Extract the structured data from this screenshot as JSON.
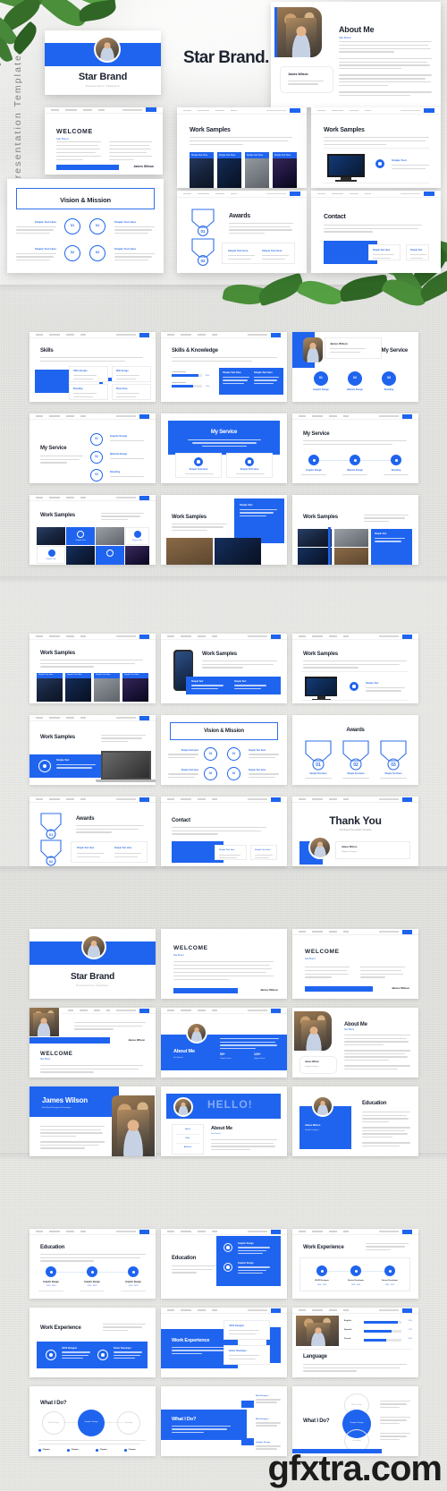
{
  "meta": {
    "side_label": "Presentation Template",
    "watermark": "gfxtra.com"
  },
  "hero": {
    "cover_title": "Star Brand",
    "cover_subtitle": "Presentation Template",
    "brand_wordmark": "Star Brand.",
    "about": {
      "title": "About Me",
      "subtitle": "Star Brand",
      "name_card": "James Wilson",
      "name_card_role": "Graphic Designer"
    },
    "slides": [
      {
        "title": "WELCOME",
        "subtitle": "Star Brand",
        "signature": "James Wilson"
      },
      {
        "title": "Work Samples",
        "tags": [
          "Simple Text Here",
          "Simple Text Here",
          "Simple Text Here",
          "Simple Text Here"
        ]
      },
      {
        "title": "Work Samples",
        "caption": "Simple Text"
      },
      {
        "title": "Vision & Mission",
        "numbers": [
          "01",
          "01",
          "02",
          "02"
        ],
        "labels": [
          "Simple Text Here",
          "Simple Text Here",
          "Simple Text Here",
          "Simple Text Here"
        ]
      },
      {
        "title": "Awards",
        "numbers": [
          "01",
          "02"
        ]
      },
      {
        "title": "Contact"
      }
    ]
  },
  "sections": [
    {
      "id": "section-a",
      "rows": [
        [
          {
            "title": "Skills",
            "type": "skills-cross",
            "cards": [
              "Office Design",
              "Web Design",
              "Branding",
              "Photoshop"
            ]
          },
          {
            "title": "Skills & Knowledge",
            "type": "skill-bars",
            "bars": [
              {
                "label": "Photoshop",
                "value": "90%"
              },
              {
                "label": "Illustrator",
                "value": "75%"
              }
            ],
            "panels": [
              "Simple Text Here",
              "Simple Text Here"
            ]
          },
          {
            "title": "My Service",
            "type": "service-circles",
            "numbers": [
              "01",
              "02",
              "03"
            ],
            "labels": [
              "Graphic Design",
              "Website Design",
              "Branding"
            ]
          }
        ],
        [
          {
            "title": "My Service",
            "type": "service-list",
            "numbers": [
              "01",
              "02",
              "03"
            ],
            "labels": [
              "Graphic Design",
              "Website Design",
              "Branding"
            ]
          },
          {
            "title": "My Service",
            "type": "service-blue",
            "cards": [
              "Simple Text Here",
              "Simple Text Here"
            ]
          },
          {
            "title": "My Service",
            "type": "service-timeline",
            "numbers": [
              "01",
              "02",
              "03"
            ],
            "labels": [
              "Graphic Design",
              "Website Design",
              "Branding"
            ]
          }
        ],
        [
          {
            "title": "Work Samples",
            "type": "work-mosaic",
            "captions": [
              "Simple Text",
              "Simple Text"
            ]
          },
          {
            "title": "Work Samples",
            "type": "work-blue-panel",
            "captions": [
              "Simple Text",
              "Simple Text"
            ]
          },
          {
            "title": "Work Samples",
            "type": "work-grid-blue",
            "captions": [
              "Simple Text"
            ]
          }
        ]
      ]
    },
    {
      "id": "section-b",
      "rows": [
        [
          {
            "title": "Work Samples",
            "type": "work-four",
            "tags": [
              "Simple Text Here",
              "Simple Text Here",
              "Simple Text Here",
              "Simple Text Here"
            ]
          },
          {
            "title": "Work Samples",
            "type": "work-phone",
            "captions": [
              "Simple Text",
              "Simple Text"
            ]
          },
          {
            "title": "Work Samples",
            "type": "work-monitor",
            "caption": "Simple Text"
          }
        ],
        [
          {
            "title": "Work Samples",
            "type": "work-laptop",
            "caption": "Simple Text"
          },
          {
            "title": "Vision & Mission",
            "type": "vision",
            "numbers": [
              "01",
              "01",
              "02",
              "02"
            ],
            "labels": [
              "Simple Text Here",
              "Simple Text Here",
              "Simple Text Here",
              "Simple Text Here"
            ]
          },
          {
            "title": "Awards",
            "type": "awards-three",
            "numbers": [
              "01",
              "02",
              "03"
            ],
            "labels": [
              "Simple Text Here",
              "Simple Text Here",
              "Simple Text Here"
            ]
          }
        ],
        [
          {
            "title": "Awards",
            "type": "awards-two",
            "numbers": [
              "01",
              "02"
            ],
            "labels": [
              "Simple Text Here",
              "Simple Text Here"
            ]
          },
          {
            "title": "Contact",
            "type": "contact",
            "cards": [
              "Simple Text Here",
              "Simple Text Here"
            ]
          },
          {
            "title": "Thank You",
            "type": "thankyou",
            "subtitle": "Star Brand Presentation Template",
            "name": "James Wilson",
            "role": "Graphic Designer"
          }
        ]
      ]
    },
    {
      "id": "section-c",
      "rows": [
        [
          {
            "title": "Star Brand",
            "type": "cover",
            "subtitle": "Presentation Template"
          },
          {
            "title": "WELCOME",
            "subtitle": "Star Brand",
            "type": "welcome-plain",
            "signature": "James Wilson"
          },
          {
            "title": "WELCOME",
            "subtitle": "Star Brand",
            "type": "welcome-cols",
            "signature": "James Wilson"
          }
        ],
        [
          {
            "title": "WELCOME",
            "subtitle": "Star Brand",
            "type": "welcome-photo",
            "signature": "James Wilson"
          },
          {
            "title": "About Me",
            "subtitle": "Star Brand",
            "type": "about-blue",
            "stats": [
              "50+",
              "120+"
            ],
            "stat_labels": [
              "Projects Done",
              "Happy Clients"
            ]
          },
          {
            "title": "About Me",
            "subtitle": "Star Brand",
            "type": "about-photo",
            "name_card": "James Wilson",
            "name_card_role": "Graphic Designer"
          }
        ],
        [
          {
            "title": "James Wilson",
            "type": "name-hero",
            "subtitle": "Star Brand Designer & Developer"
          },
          {
            "title": "About Me",
            "subtitle": "Star Brand",
            "type": "hello",
            "banner": "HELLO!",
            "list": [
              "Name",
              "Role",
              "Address"
            ]
          },
          {
            "title": "Education",
            "type": "education-blue",
            "name_card": "James Wilson",
            "name_card_role": "Graphic Designer"
          }
        ]
      ]
    },
    {
      "id": "section-d",
      "rows": [
        [
          {
            "title": "Education",
            "type": "edu-timeline",
            "items": [
              "Graphic Design",
              "Graphic Design",
              "Graphic Design"
            ],
            "years": [
              "2016 - 2018",
              "2016 - 2018",
              "2016 - 2018"
            ]
          },
          {
            "title": "Education",
            "type": "edu-blue-cards",
            "items": [
              "Graphic Design",
              "Graphic Design"
            ]
          },
          {
            "title": "Work Experience",
            "type": "work-exp-timeline",
            "items": [
              "UI/UX Designer",
              "Senior Developer",
              "Senior Developer"
            ],
            "years": [
              "2016 - 2018",
              "2018 - 2020",
              "2020 - 2022"
            ]
          }
        ],
        [
          {
            "title": "Work Experience",
            "type": "work-exp-blue",
            "items": [
              "UI/UX Designer",
              "Senior Developer"
            ]
          },
          {
            "title": "Work Experience",
            "type": "work-exp-cards",
            "items": [
              "UI/UX Designer",
              "Senior Developer"
            ]
          },
          {
            "title": "Language",
            "type": "language",
            "bars": [
              {
                "label": "English",
                "value": "90%"
              },
              {
                "label": "Spanish",
                "value": "75%"
              },
              {
                "label": "French",
                "value": "60%"
              }
            ]
          }
        ],
        [
          {
            "title": "What I Do?",
            "type": "whatido-circles",
            "circles": [
              "Web Design",
              "Graphic Design",
              "Branding"
            ],
            "legend": [
              "Chapter",
              "Chapter",
              "Chapter",
              "Chapter"
            ]
          },
          {
            "title": "What I Do?",
            "type": "whatido-blue",
            "items": [
              "Web Designer",
              "Web Designer",
              "Graphic Design"
            ]
          },
          {
            "title": "What I Do?",
            "type": "whatido-venn",
            "circles": [
              "Web Design",
              "Graphic Design",
              "Branding"
            ]
          }
        ]
      ]
    }
  ],
  "theme": {
    "accent": "#1f64ef",
    "accent_dark": "#0f4fd8",
    "ink": "#1d2330",
    "muted": "#8b8b8b",
    "page_bg": "#e2e2df"
  }
}
